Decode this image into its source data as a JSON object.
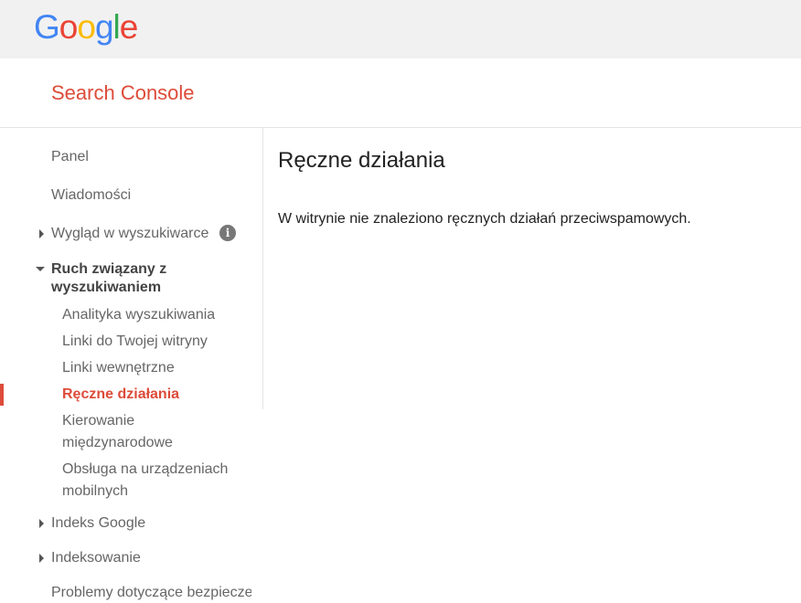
{
  "header": {
    "logo_letters": [
      {
        "char": "G",
        "color": "#4285F4"
      },
      {
        "char": "o",
        "color": "#EA4335"
      },
      {
        "char": "o",
        "color": "#FBBC05"
      },
      {
        "char": "g",
        "color": "#4285F4"
      },
      {
        "char": "l",
        "color": "#34A853"
      },
      {
        "char": "e",
        "color": "#EA4335"
      }
    ],
    "product_title": "Search Console",
    "product_color": "#dd4b39"
  },
  "sidebar": {
    "items": [
      {
        "label": "Panel"
      },
      {
        "label": "Wiadomości"
      },
      {
        "label": "Wygląd w wyszukiwarce",
        "icon": "info-icon",
        "collapsed": true
      },
      {
        "label": "Ruch związany z wyszukiwaniem",
        "expanded": true,
        "children": [
          {
            "label": "Analityka wyszukiwania"
          },
          {
            "label": "Linki do Twojej witryny"
          },
          {
            "label": "Linki wewnętrzne"
          },
          {
            "label": "Ręczne działania",
            "active": true
          },
          {
            "label": "Kierowanie międzynarodowe"
          },
          {
            "label": "Obsługa na urządzeniach mobilnych"
          }
        ]
      },
      {
        "label": "Indeks Google",
        "collapsed": true
      },
      {
        "label": "Indeksowanie",
        "collapsed": true
      },
      {
        "label": "Problemy dotyczące bezpieczeństwa"
      }
    ],
    "info_glyph": "i"
  },
  "main": {
    "title": "Ręczne działania",
    "message": "W witrynie nie znaleziono ręcznych działań przeciwspamowych."
  }
}
